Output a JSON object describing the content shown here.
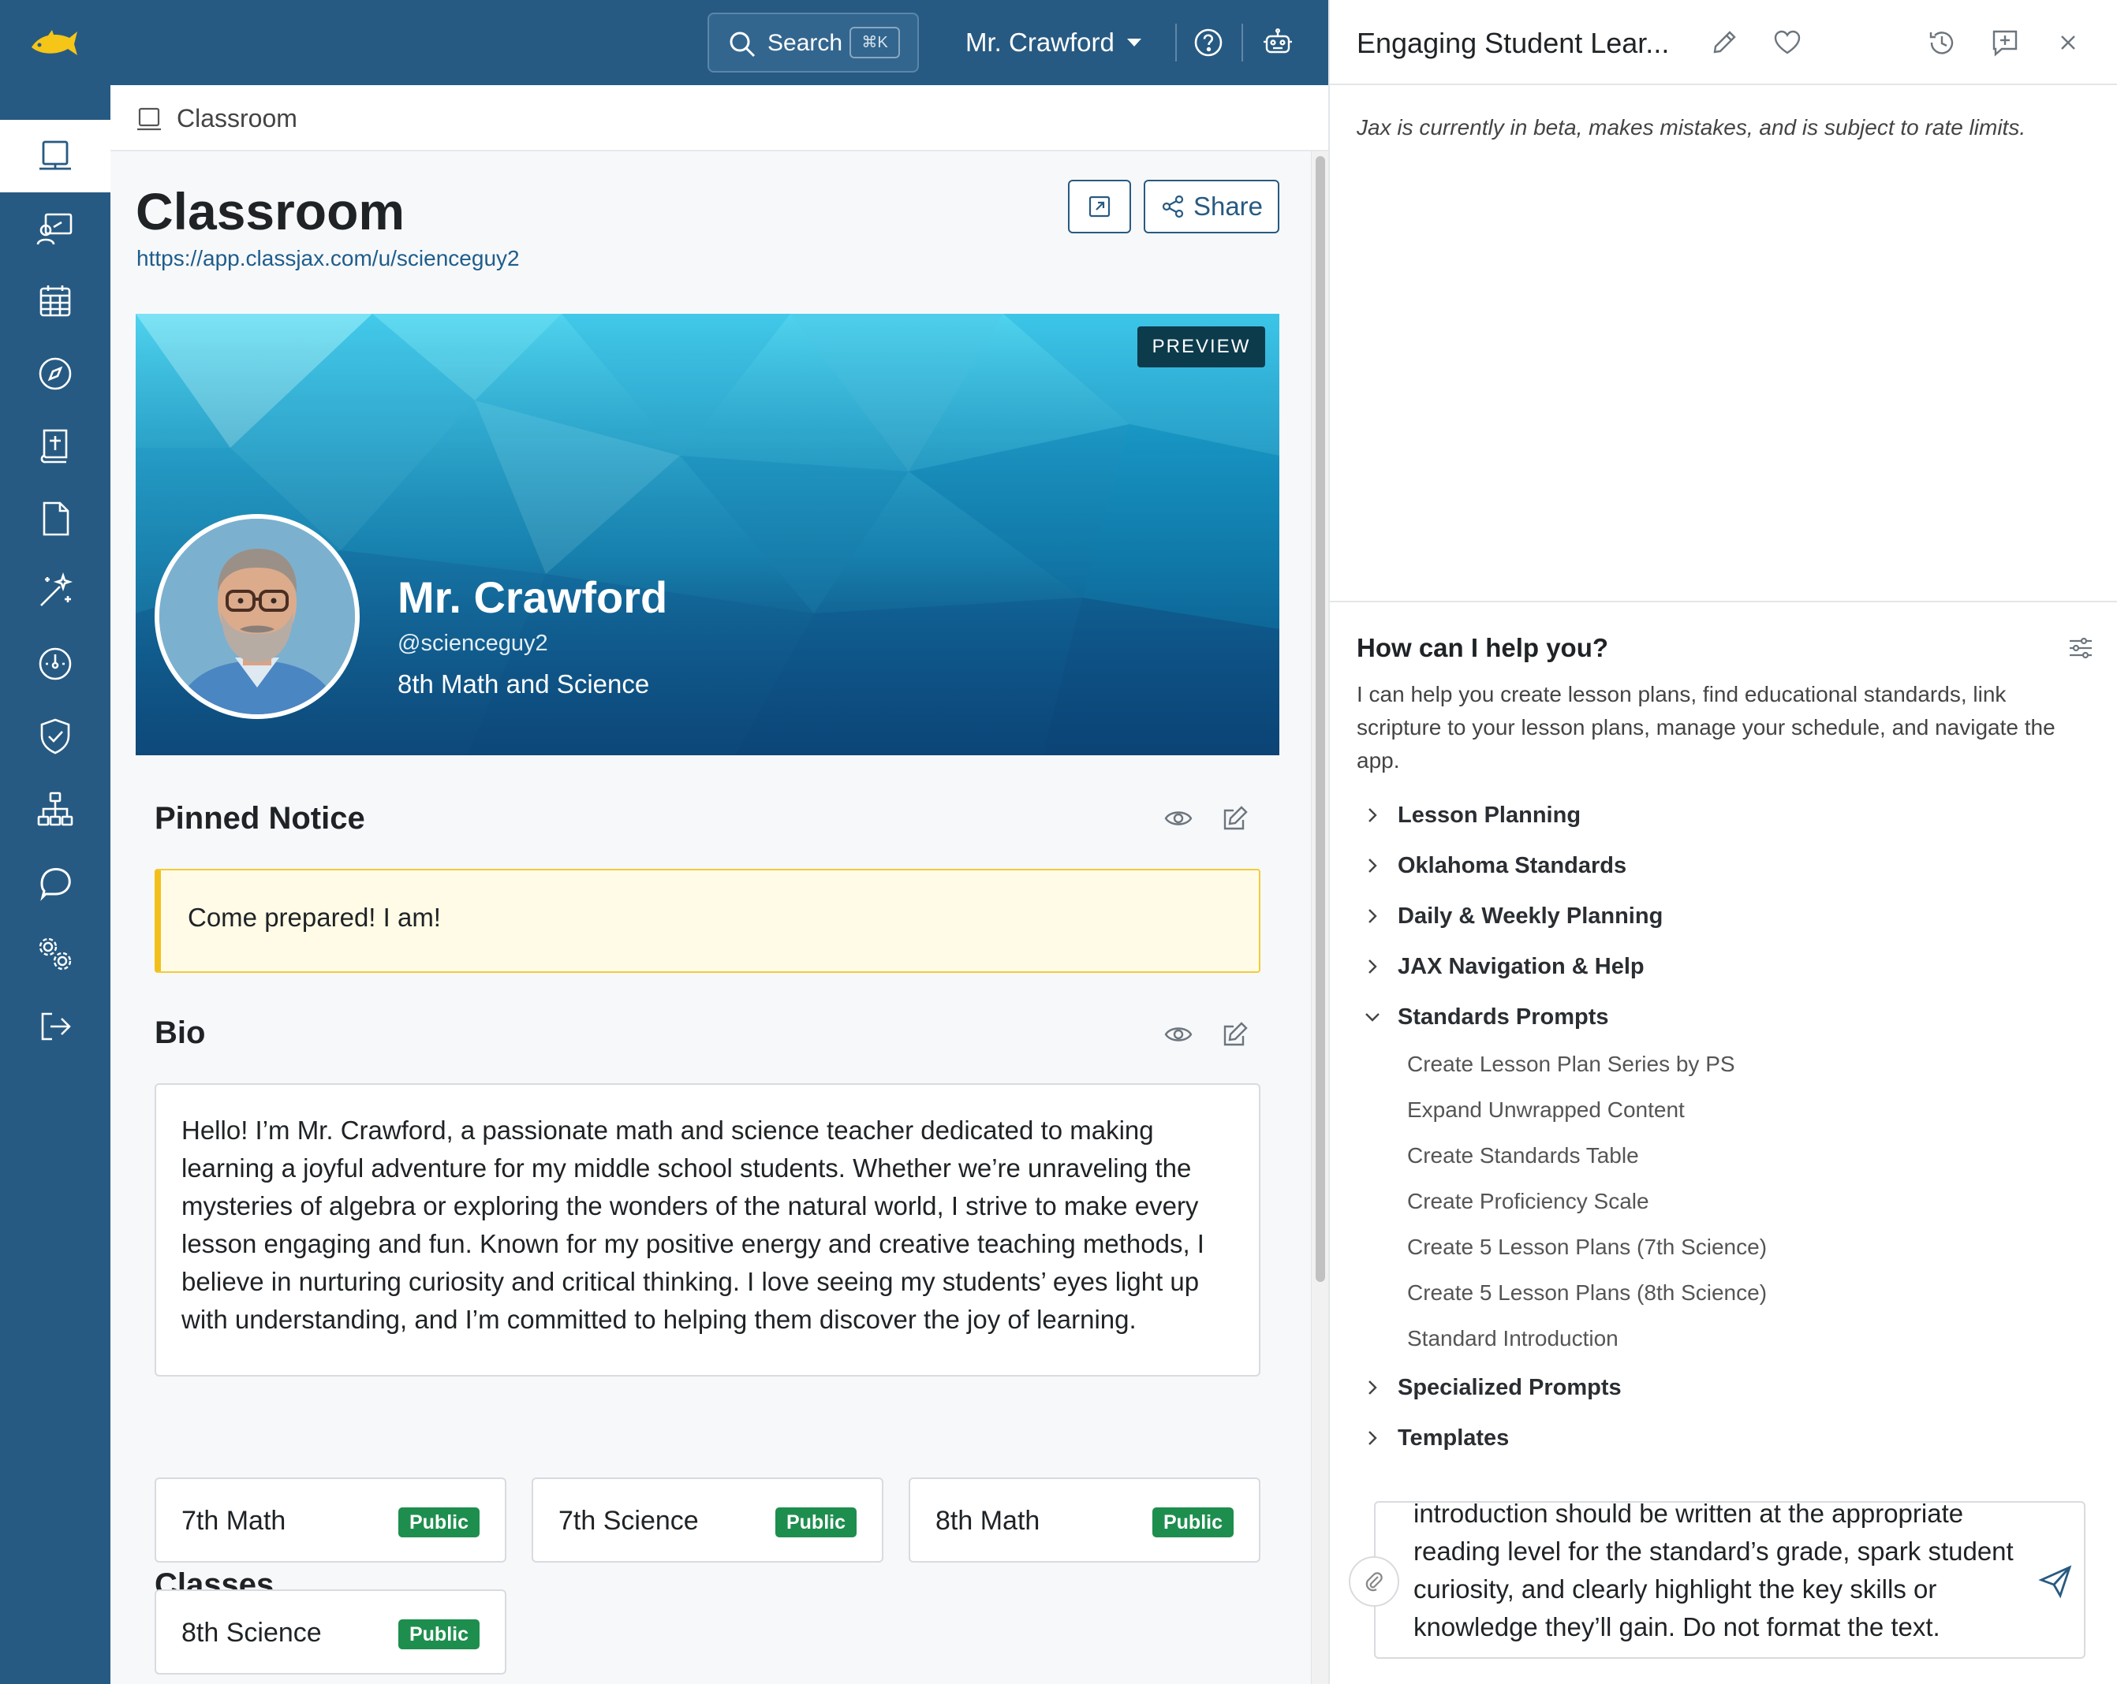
{
  "topbar": {
    "search_label": "Search",
    "search_shortcut": "⌘K",
    "user_name": "Mr. Crawford"
  },
  "nav": {
    "items": [
      "classroom",
      "teacher",
      "calendar",
      "explore",
      "bible",
      "document",
      "magic",
      "dashboard",
      "shield",
      "org-chart",
      "jax",
      "settings",
      "logout"
    ],
    "active": "classroom"
  },
  "breadcrumb": {
    "label": "Classroom"
  },
  "page": {
    "title": "Classroom",
    "url": "https://app.classjax.com/u/scienceguy2",
    "share_label": "Share"
  },
  "profile": {
    "preview_badge": "PREVIEW",
    "name": "Mr. Crawford",
    "handle": "@scienceguy2",
    "subject": "8th Math and Science"
  },
  "pinned_notice": {
    "title": "Pinned Notice",
    "text": "Come prepared! I am!"
  },
  "bio": {
    "title": "Bio",
    "text": "Hello! I’m Mr. Crawford, a passionate math and science teacher dedicated to making learning a joyful adventure for my middle school students. Whether we’re unraveling the mysteries of algebra or exploring the wonders of the natural world, I strive to make every lesson engaging and fun. Known for my positive energy and creative teaching methods, I believe in nurturing curiosity and critical thinking. I love seeing my students’ eyes light up with understanding, and I’m committed to helping them discover the joy of learning."
  },
  "classes": {
    "title": "Classes",
    "items": [
      {
        "name": "7th Math",
        "badge": "Public"
      },
      {
        "name": "7th Science",
        "badge": "Public"
      },
      {
        "name": "8th Math",
        "badge": "Public"
      },
      {
        "name": "8th Science",
        "badge": "Public"
      }
    ]
  },
  "jax_panel": {
    "title": "Engaging Student Lear...",
    "beta_notice": "Jax is currently in beta, makes mistakes, and is subject to rate limits.",
    "help_title": "How can I help you?",
    "help_description": "I can help you create lesson plans, find educational standards, link scripture to your lesson plans, manage your schedule, and navigate the app.",
    "categories": [
      {
        "label": "Lesson Planning",
        "expanded": false
      },
      {
        "label": "Oklahoma Standards",
        "expanded": false
      },
      {
        "label": "Daily & Weekly Planning",
        "expanded": false
      },
      {
        "label": "JAX Navigation & Help",
        "expanded": false
      },
      {
        "label": "Standards Prompts",
        "expanded": true
      },
      {
        "label": "Specialized Prompts",
        "expanded": false
      },
      {
        "label": "Templates",
        "expanded": false
      }
    ],
    "standards_prompts": [
      "Create Lesson Plan Series by PS",
      "Expand Unwrapped Content",
      "Create Standards Table",
      "Create Proficiency Scale",
      "Create 5 Lesson Plans (7th Science)",
      "Create 5 Lesson Plans (8th Science)",
      "Standard Introduction"
    ],
    "input_value": "introduction should be written at the appropriate reading level for the standard’s grade, spark student curiosity, and clearly highlight the key skills or knowledge they’ll gain. Do not format the text."
  },
  "colors": {
    "brand": "#275a82",
    "public_badge": "#1e8e4e",
    "notice_border": "#f2c01c",
    "notice_bg": "#fffbe6"
  }
}
